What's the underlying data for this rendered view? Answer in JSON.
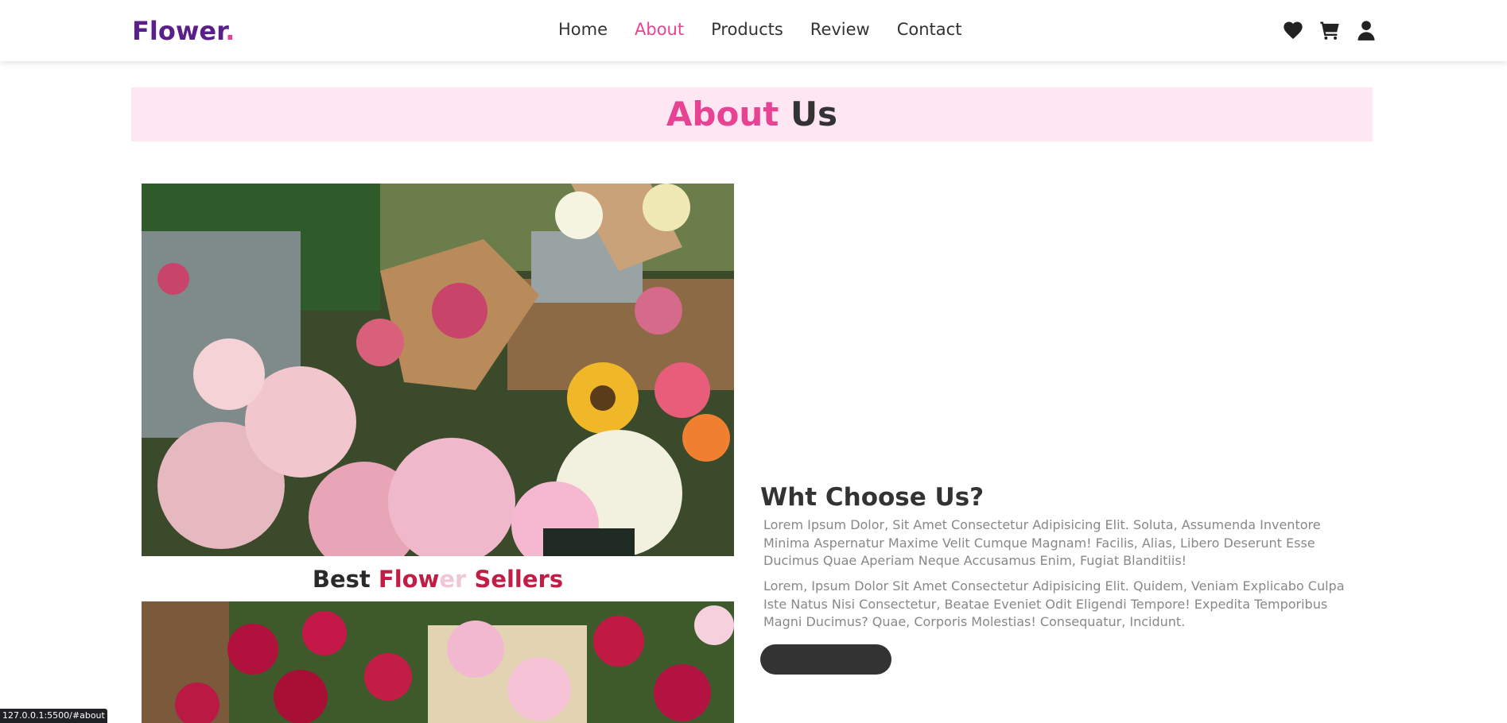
{
  "header": {
    "logo_text": "Flower",
    "logo_dot": ".",
    "nav": [
      {
        "label": "Home"
      },
      {
        "label": "About",
        "active": true
      },
      {
        "label": "Products"
      },
      {
        "label": "Review"
      },
      {
        "label": "Contact"
      }
    ],
    "icons": [
      "heart-icon",
      "cart-icon",
      "user-icon"
    ]
  },
  "about": {
    "heading_accent": "About",
    "heading_rest": "Us",
    "image_caption": {
      "part1": "Best ",
      "part2": "Flow",
      "part3": "er ",
      "part4": "Sellers"
    },
    "why_title": "Wht Choose Us?",
    "paragraph_1": "Lorem Ipsum Dolor, Sit Amet Consectetur Adipisicing Elit. Soluta, Assumenda Inventore Minima Aspernatur Maxime Velit Cumque Magnam! Facilis, Alias, Libero Deserunt Esse Ducimus Quae Aperiam Neque Accusamus Enim, Fugiat Blanditiis!",
    "paragraph_2": "Lorem, Ipsum Dolor Sit Amet Consectetur Adipisicing Elit. Quidem, Veniam Explicabo Culpa Iste Natus Nisi Consectetur, Beatae Eveniet Odit Eligendi Tempore! Expedita Temporibus Magni Ducimus? Quae, Corporis Molestias! Consequatur, Incidunt.",
    "button_label": ""
  },
  "status_bar": {
    "url": "127.0.0.1:5500/#about"
  },
  "colors": {
    "brand_purple": "#5b1f8a",
    "accent_pink": "#e84393",
    "heading_band": "#ffe6f3",
    "dark": "#333333"
  }
}
